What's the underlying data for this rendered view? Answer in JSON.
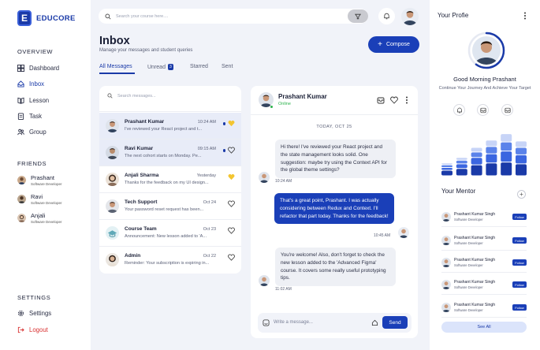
{
  "brand": {
    "letter": "E",
    "name": "EDUCORE"
  },
  "sidebar": {
    "overview_title": "OVERVIEW",
    "nav": [
      {
        "label": "Dashboard",
        "icon": "dashboard-icon"
      },
      {
        "label": "Inbox",
        "icon": "inbox-icon",
        "active": true
      },
      {
        "label": "Lesson",
        "icon": "book-icon"
      },
      {
        "label": "Task",
        "icon": "task-icon"
      },
      {
        "label": "Group",
        "icon": "group-icon"
      }
    ],
    "friends_title": "FRIENDS",
    "friends": [
      {
        "name": "Prashant",
        "role": "Software Developer"
      },
      {
        "name": "Ravi",
        "role": "Software Developer"
      },
      {
        "name": "Anjali",
        "role": "Software Developer"
      }
    ],
    "settings_title": "SETTINGS",
    "settings_label": "Settings",
    "logout_label": "Logout"
  },
  "header": {
    "search_placeholder": "Search your course here...."
  },
  "inbox": {
    "title": "Inbox",
    "subtitle": "Manage your messages and student queries",
    "compose_label": "Compose",
    "tabs": [
      {
        "label": "All Messages",
        "active": true
      },
      {
        "label": "Unread",
        "badge": "3"
      },
      {
        "label": "Starred"
      },
      {
        "label": "Sent"
      }
    ],
    "search_placeholder": "Search messages..."
  },
  "messages": [
    {
      "name": "Prashant Kumar",
      "preview": "I've reviewed your React project and t...",
      "time": "10:24 AM",
      "unread": true,
      "starred": true,
      "selected": true
    },
    {
      "name": "Ravi Kumar",
      "preview": "The next cohort starts on Monday. Pe...",
      "time": "09:15 AM",
      "unread": true,
      "starred": false,
      "selected": true
    },
    {
      "name": "Anjali Sharma",
      "preview": "Thanks for the feedback on my UI design...",
      "time": "Yesterday",
      "unread": false,
      "starred": true
    },
    {
      "name": "Tech Support",
      "preview": "Your password reset request has been...",
      "time": "Oct 24",
      "unread": false,
      "starred": false
    },
    {
      "name": "Course Team",
      "preview": "Announcement: New lesson added to 'A...",
      "time": "Oct 23",
      "unread": false,
      "starred": false
    },
    {
      "name": "Admin",
      "preview": "Reminder: Your subscription is expiring in...",
      "time": "Oct 22",
      "unread": false,
      "starred": false
    }
  ],
  "chat": {
    "name": "Prashant Kumar",
    "status": "Online",
    "date_label": "TODAY, OCT 25",
    "bubbles": [
      {
        "from": "them",
        "text": "Hi there! I've reviewed your React project and the state management looks solid. One suggestion: maybe try using the Context API for the global theme settings?",
        "time": "10:24 AM"
      },
      {
        "from": "me",
        "text": "That's a great point, Prashant. I was actually considering between Redux and Context. I'll refactor that part today. Thanks for the feedback!",
        "time": "10:45 AM"
      },
      {
        "from": "them",
        "text": "You're welcome! Also, don't forget to check the new lesson added to the 'Advanced Figma' course. It covers some really useful prototyping tips.",
        "time": "11:02 AM"
      }
    ],
    "input_placeholder": "Write a message...",
    "send_label": "Send"
  },
  "profile": {
    "title": "Your Profie",
    "greeting": "Good Morning Prashant",
    "subtitle": "Continue Your Journey And Achieve Your Target",
    "progress_fraction": 0.6,
    "colors": {
      "dark": "#1a3aa8",
      "mid": "#3b66e0",
      "light": "#c7d4f7"
    }
  },
  "chart_data": {
    "type": "bar",
    "stacked": true,
    "categories": [
      "1",
      "2",
      "3",
      "4",
      "5",
      "6"
    ],
    "series": [
      {
        "values": [
          6,
          8,
          12,
          14,
          15,
          13
        ]
      },
      {
        "values": [
          3,
          5,
          8,
          10,
          12,
          10
        ]
      },
      {
        "values": [
          3,
          4,
          6,
          8,
          10,
          8
        ]
      },
      {
        "values": [
          2,
          3,
          5,
          7,
          9,
          7
        ]
      }
    ],
    "ylim": [
      0,
      50
    ],
    "grid": false
  },
  "mentors": {
    "title": "Your Mentor",
    "items": [
      {
        "name": "Prashant Kumar Singh",
        "role": "Software Developer",
        "action": "Follow"
      },
      {
        "name": "Prashant Kumar Singh",
        "role": "Software Developer",
        "action": "Follow"
      },
      {
        "name": "Prashant Kumar Singh",
        "role": "Software Developer",
        "action": "Follow"
      },
      {
        "name": "Prashant Kumar Singh",
        "role": "Software Developer",
        "action": "Follow"
      },
      {
        "name": "Prashant Kumar Singh",
        "role": "Software Developer",
        "action": "Follow"
      }
    ],
    "see_all_label": "See All"
  }
}
